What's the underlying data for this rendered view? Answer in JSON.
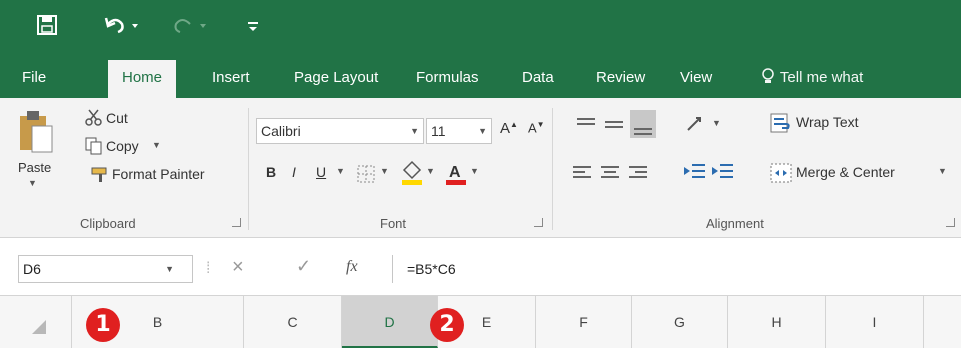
{
  "qat": {
    "save_icon": "save-icon",
    "undo_icon": "undo-icon",
    "redo_icon": "redo-icon",
    "customize_icon": "customize-qat-icon"
  },
  "tabs": [
    {
      "label": "File"
    },
    {
      "label": "Home",
      "active": true
    },
    {
      "label": "Insert"
    },
    {
      "label": "Page Layout"
    },
    {
      "label": "Formulas"
    },
    {
      "label": "Data"
    },
    {
      "label": "Review"
    },
    {
      "label": "View"
    },
    {
      "label": "Tell me what"
    }
  ],
  "clipboard": {
    "paste": "Paste",
    "cut": "Cut",
    "copy": "Copy",
    "format_painter": "Format Painter",
    "group_label": "Clipboard"
  },
  "font": {
    "family": "Calibri",
    "size": "11",
    "bold": "B",
    "italic": "I",
    "underline": "U",
    "group_label": "Font"
  },
  "alignment": {
    "wrap_text": "Wrap Text",
    "merge_center": "Merge & Center",
    "group_label": "Alignment"
  },
  "formula_bar": {
    "name_box": "D6",
    "formula": "=B5*C6"
  },
  "columns": [
    "B",
    "C",
    "D",
    "E",
    "F",
    "G",
    "H",
    "I"
  ],
  "selected_column": "D",
  "markers": [
    "1",
    "2"
  ],
  "colors": {
    "excel_green": "#217346",
    "marker_red": "#e02020"
  }
}
